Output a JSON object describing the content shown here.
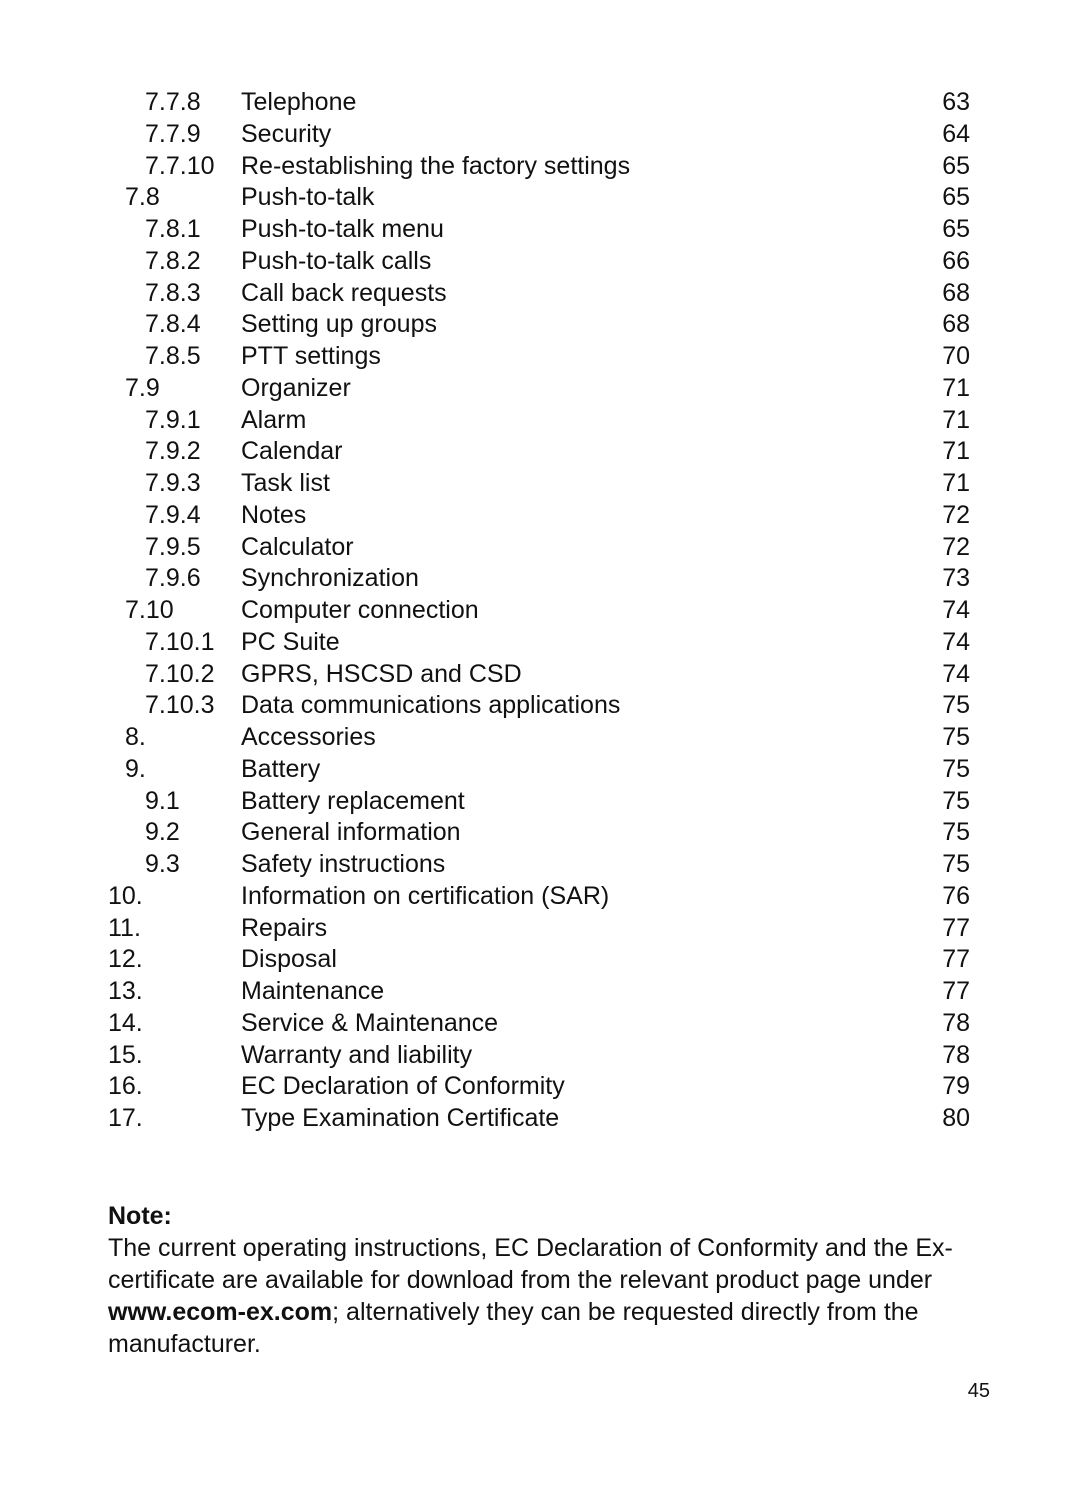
{
  "toc": [
    {
      "level": 3,
      "number": "7.7.8",
      "title": "Telephone",
      "page": "63"
    },
    {
      "level": 3,
      "number": "7.7.9",
      "title": "Security",
      "page": "64"
    },
    {
      "level": 3,
      "number": "7.7.10",
      "title": "Re-establishing the factory settings",
      "page": "65"
    },
    {
      "level": 2,
      "number": "7.8",
      "title": "Push-to-talk",
      "page": "65"
    },
    {
      "level": 3,
      "number": "7.8.1",
      "title": "Push-to-talk menu",
      "page": "65"
    },
    {
      "level": 3,
      "number": "7.8.2",
      "title": "Push-to-talk calls",
      "page": "66"
    },
    {
      "level": 3,
      "number": "7.8.3",
      "title": "Call back requests",
      "page": "68"
    },
    {
      "level": 3,
      "number": "7.8.4",
      "title": "Setting up groups",
      "page": "68"
    },
    {
      "level": 3,
      "number": "7.8.5",
      "title": "PTT settings",
      "page": "70"
    },
    {
      "level": 2,
      "number": "7.9",
      "title": "Organizer",
      "page": "71"
    },
    {
      "level": 3,
      "number": "7.9.1",
      "title": "Alarm",
      "page": "71"
    },
    {
      "level": 3,
      "number": "7.9.2",
      "title": "Calendar",
      "page": "71"
    },
    {
      "level": 3,
      "number": "7.9.3",
      "title": "Task list",
      "page": "71"
    },
    {
      "level": 3,
      "number": "7.9.4",
      "title": "Notes",
      "page": "72"
    },
    {
      "level": 3,
      "number": "7.9.5",
      "title": "Calculator",
      "page": "72"
    },
    {
      "level": 3,
      "number": "7.9.6",
      "title": "Synchronization",
      "page": "73"
    },
    {
      "level": 2,
      "number": "7.10",
      "title": "Computer connection",
      "page": "74"
    },
    {
      "level": 3,
      "number": "7.10.1",
      "title": "PC Suite",
      "page": "74"
    },
    {
      "level": 3,
      "number": "7.10.2",
      "title": "GPRS, HSCSD and CSD",
      "page": "74"
    },
    {
      "level": 3,
      "number": "7.10.3",
      "title": "Data communications applications",
      "page": "75"
    },
    {
      "level": 2,
      "number": "8.",
      "title": "Accessories",
      "page": "75"
    },
    {
      "level": 2,
      "number": "9.",
      "title": "Battery",
      "page": "75"
    },
    {
      "level": 3,
      "number": "9.1",
      "title": "Battery replacement",
      "page": "75"
    },
    {
      "level": 3,
      "number": "9.2",
      "title": "General information",
      "page": "75"
    },
    {
      "level": 3,
      "number": "9.3",
      "title": "Safety instructions",
      "page": "75"
    },
    {
      "level": 1,
      "number": "10.",
      "title": "Information on certification (SAR)",
      "page": "76"
    },
    {
      "level": 1,
      "number": "11.",
      "title": "Repairs",
      "page": "77"
    },
    {
      "level": 1,
      "number": "12.",
      "title": "Disposal",
      "page": "77"
    },
    {
      "level": 1,
      "number": "13.",
      "title": "Maintenance",
      "page": "77"
    },
    {
      "level": 1,
      "number": "14.",
      "title": "Service & Maintenance",
      "page": "78"
    },
    {
      "level": 1,
      "number": "15.",
      "title": "Warranty and liability",
      "page": "78"
    },
    {
      "level": 1,
      "number": "16.",
      "title": "EC Declaration of Conformity",
      "page": "79"
    },
    {
      "level": 1,
      "number": "17.",
      "title": "Type Examination Certificate",
      "page": "80"
    }
  ],
  "note": {
    "heading": "Note:",
    "text_before": "The current operating instructions, EC Declaration of Conformity and the Ex-certificate are available for download from the relevant product page under ",
    "link": "www.ecom-ex.com",
    "text_after": "; alternatively they can be requested directly from the manufacturer."
  },
  "page_number": "45"
}
